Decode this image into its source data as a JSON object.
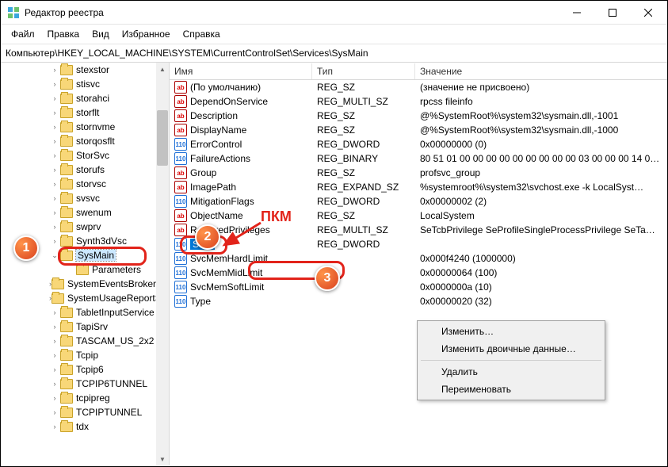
{
  "window": {
    "title": "Редактор реестра"
  },
  "menu": [
    "Файл",
    "Правка",
    "Вид",
    "Избранное",
    "Справка"
  ],
  "address": "Компьютер\\HKEY_LOCAL_MACHINE\\SYSTEM\\CurrentControlSet\\Services\\SysMain",
  "columns": {
    "name": "Имя",
    "type": "Тип",
    "value": "Значение"
  },
  "tree": [
    {
      "label": "stexstor"
    },
    {
      "label": "stisvc"
    },
    {
      "label": "storahci"
    },
    {
      "label": "storflt"
    },
    {
      "label": "stornvme"
    },
    {
      "label": "storqosflt"
    },
    {
      "label": "StorSvc"
    },
    {
      "label": "storufs"
    },
    {
      "label": "storvsc"
    },
    {
      "label": "svsvc"
    },
    {
      "label": "swenum"
    },
    {
      "label": "swprv"
    },
    {
      "label": "Synth3dVsc"
    },
    {
      "label": "SysMain",
      "selected": true,
      "expanded": true
    },
    {
      "label": "Parameters",
      "child": true
    },
    {
      "label": "SystemEventsBroker"
    },
    {
      "label": "SystemUsageReportSvc"
    },
    {
      "label": "TabletInputService"
    },
    {
      "label": "TapiSrv"
    },
    {
      "label": "TASCAM_US_2x2"
    },
    {
      "label": "Tcpip"
    },
    {
      "label": "Tcpip6"
    },
    {
      "label": "TCPIP6TUNNEL"
    },
    {
      "label": "tcpipreg"
    },
    {
      "label": "TCPIPTUNNEL"
    },
    {
      "label": "tdx"
    }
  ],
  "rows": [
    {
      "icon": "sz",
      "name": "(По умолчанию)",
      "type": "REG_SZ",
      "value": "(значение не присвоено)"
    },
    {
      "icon": "sz",
      "name": "DependOnService",
      "type": "REG_MULTI_SZ",
      "value": "rpcss fileinfo"
    },
    {
      "icon": "sz",
      "name": "Description",
      "type": "REG_SZ",
      "value": "@%SystemRoot%\\system32\\sysmain.dll,-1001"
    },
    {
      "icon": "sz",
      "name": "DisplayName",
      "type": "REG_SZ",
      "value": "@%SystemRoot%\\system32\\sysmain.dll,-1000"
    },
    {
      "icon": "bn",
      "name": "ErrorControl",
      "type": "REG_DWORD",
      "value": "0x00000000 (0)"
    },
    {
      "icon": "bn",
      "name": "FailureActions",
      "type": "REG_BINARY",
      "value": "80 51 01 00 00 00 00 00 00 00 00 00 03 00 00 00 14 00…"
    },
    {
      "icon": "sz",
      "name": "Group",
      "type": "REG_SZ",
      "value": "profsvc_group"
    },
    {
      "icon": "sz",
      "name": "ImagePath",
      "type": "REG_EXPAND_SZ",
      "value": "%systemroot%\\system32\\svchost.exe -k LocalSyst…"
    },
    {
      "icon": "bn",
      "name": "MitigationFlags",
      "type": "REG_DWORD",
      "value": "0x00000002 (2)"
    },
    {
      "icon": "sz",
      "name": "ObjectName",
      "type": "REG_SZ",
      "value": "LocalSystem"
    },
    {
      "icon": "sz",
      "name": "RequiredPrivileges",
      "type": "REG_MULTI_SZ",
      "value": "SeTcbPrivilege SeProfileSingleProcessPrivilege SeTa…"
    },
    {
      "icon": "bn",
      "name": "Start",
      "type": "REG_DWORD",
      "value": "",
      "selected": true
    },
    {
      "icon": "bn",
      "name": "SvcMemHardLimit",
      "type": "",
      "value": "0x000f4240 (1000000)"
    },
    {
      "icon": "bn",
      "name": "SvcMemMidLimit",
      "type": "",
      "value": "0x00000064 (100)"
    },
    {
      "icon": "bn",
      "name": "SvcMemSoftLimit",
      "type": "",
      "value": "0x0000000a (10)"
    },
    {
      "icon": "bn",
      "name": "Type",
      "type": "",
      "value": "0x00000020 (32)"
    }
  ],
  "context": {
    "modify": "Изменить…",
    "modifyBin": "Изменить двоичные данные…",
    "delete": "Удалить",
    "rename": "Переименовать"
  },
  "annot": {
    "pkm": "ПКМ",
    "b1": "1",
    "b2": "2",
    "b3": "3"
  }
}
